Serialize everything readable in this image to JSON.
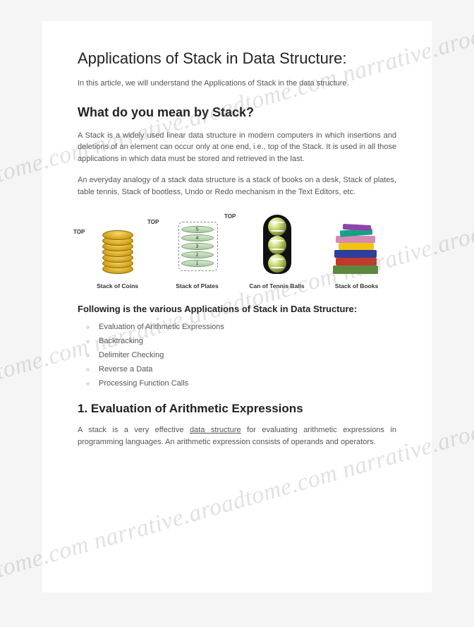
{
  "title": "Applications of Stack in Data Structure:",
  "intro": "In this article, we will understand the Applications of Stack in the data structure.",
  "h2_1": "What do you mean by Stack?",
  "para1": "A Stack is a widely used linear data structure in modern computers in which insertions and deletions of an element can occur only at one end, i.e., top of the Stack. It is used in all those applications in which data must be stored and retrieved in the last.",
  "para2": "An everyday analogy of a stack data structure is a stack of books on a desk, Stack of plates, table tennis, Stack of bootless, Undo or Redo mechanism in the Text Editors, etc.",
  "diagram": {
    "top_label": "TOP",
    "plate_numbers": [
      "5",
      "4",
      "3",
      "2",
      "1"
    ],
    "captions": {
      "coins": "Stack of Coins",
      "plates": "Stack of Plates",
      "can": "Can of Tennis Balls",
      "books": "Stack of Books"
    }
  },
  "h3": "Following is the various Applications of Stack in Data Structure:",
  "apps": [
    "Evaluation of Arithmetic Expressions",
    "Backtracking",
    "Delimiter Checking",
    "Reverse a Data",
    "Processing Function Calls"
  ],
  "h2_2": "1. Evaluation of Arithmetic Expressions",
  "para3_a": "A stack is a very effective ",
  "para3_link": "data structure",
  "para3_b": " for evaluating arithmetic expressions in programming languages. An arithmetic expression consists of operands and operators.",
  "watermark": "narrative.aroadtome.com   narrative.aroadtome.com   narrative.aroadtome.com"
}
